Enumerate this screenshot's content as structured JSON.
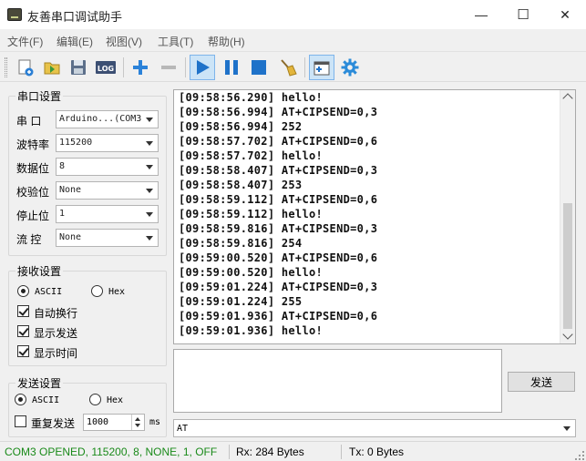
{
  "window": {
    "title": "友善串口调试助手",
    "minimize": "—",
    "maximize": "☐",
    "close": "✕"
  },
  "menu": [
    "文件(F)",
    "编辑(E)",
    "视图(V)",
    "工具(T)",
    "帮助(H)"
  ],
  "toolbar": {
    "log_label": "LOG",
    "icons": [
      "new-icon",
      "open-icon",
      "save-icon",
      "log-icon",
      "plus-icon",
      "minus-icon",
      "play-icon",
      "pause-icon",
      "stop-icon",
      "clear-broom-icon",
      "new-window-icon",
      "gear-icon"
    ]
  },
  "serial": {
    "title": "串口设置",
    "port_label": "串  口",
    "port_value": "Arduino...(COM3",
    "baud_label": "波特率",
    "baud_value": "115200",
    "databits_label": "数据位",
    "databits_value": "8",
    "parity_label": "校验位",
    "parity_value": "None",
    "stopbits_label": "停止位",
    "stopbits_value": "1",
    "flow_label": "流  控",
    "flow_value": "None"
  },
  "receive_settings": {
    "title": "接收设置",
    "ascii": "ASCII",
    "hex": "Hex",
    "auto_wrap": "自动换行",
    "show_send": "显示发送",
    "show_time": "显示时间"
  },
  "send_settings": {
    "title": "发送设置",
    "ascii": "ASCII",
    "hex": "Hex",
    "repeat": "重复发送",
    "interval": "1000",
    "unit": "ms"
  },
  "log": [
    "[09:58:56.290] hello!",
    "[09:58:56.994] AT+CIPSEND=0,3",
    "[09:58:56.994] 252",
    "[09:58:57.702] AT+CIPSEND=0,6",
    "[09:58:57.702] hello!",
    "[09:58:58.407] AT+CIPSEND=0,3",
    "[09:58:58.407] 253",
    "[09:58:59.112] AT+CIPSEND=0,6",
    "[09:58:59.112] hello!",
    "[09:58:59.816] AT+CIPSEND=0,3",
    "[09:58:59.816] 254",
    "[09:59:00.520] AT+CIPSEND=0,6",
    "[09:59:00.520] hello!",
    "[09:59:01.224] AT+CIPSEND=0,3",
    "[09:59:01.224] 255",
    "[09:59:01.936] AT+CIPSEND=0,6",
    "[09:59:01.936] hello!"
  ],
  "send": {
    "button": "发送",
    "command": "AT"
  },
  "status": {
    "connection": "COM3 OPENED, 115200, 8, NONE, 1, OFF",
    "rx": "Rx: 284 Bytes",
    "tx": "Tx: 0 Bytes",
    "connection_color": "#1a8a1a"
  }
}
